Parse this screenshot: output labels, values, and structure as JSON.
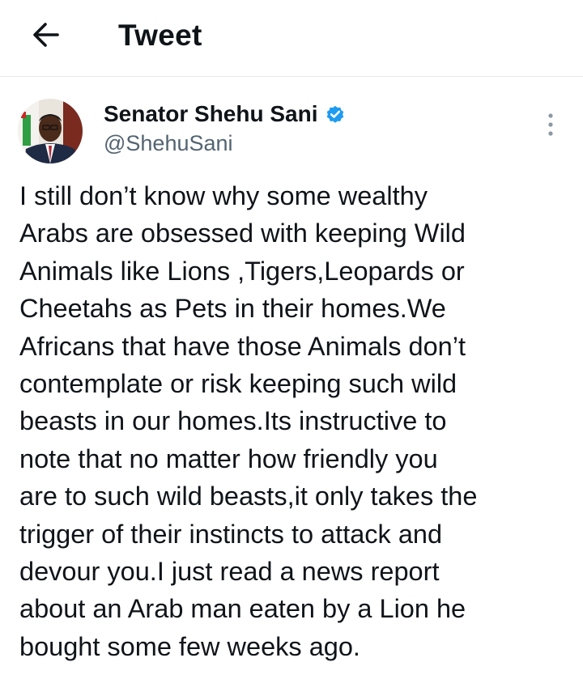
{
  "header": {
    "back_icon": "arrow-left-icon",
    "title": "Tweet"
  },
  "tweet": {
    "author": {
      "display_name": "Senator Shehu Sani",
      "handle": "@ShehuSani",
      "verified": true,
      "verified_icon": "verified-badge-icon",
      "verified_color": "#1d9bf0"
    },
    "more_icon": "more-options-vertical-icon",
    "text": "I still don’t know why some wealthy\nArabs are obsessed with keeping Wild\nAnimals like Lions ,Tigers,Leopards or\nCheetahs as Pets in their homes.We\nAfricans that have those Animals don’t\ncontemplate or risk keeping such wild\nbeasts in our homes.Its instructive to\nnote that no matter how friendly you\nare to such wild beasts,it only takes the\ntrigger of their instincts to attack and\ndevour you.I just read a news report\nabout an Arab man eaten by a Lion he\nbought some few weeks ago."
  },
  "colors": {
    "text_primary": "#0f1419",
    "text_secondary": "#536471",
    "divider": "#e6e9eb",
    "accent": "#1d9bf0"
  }
}
